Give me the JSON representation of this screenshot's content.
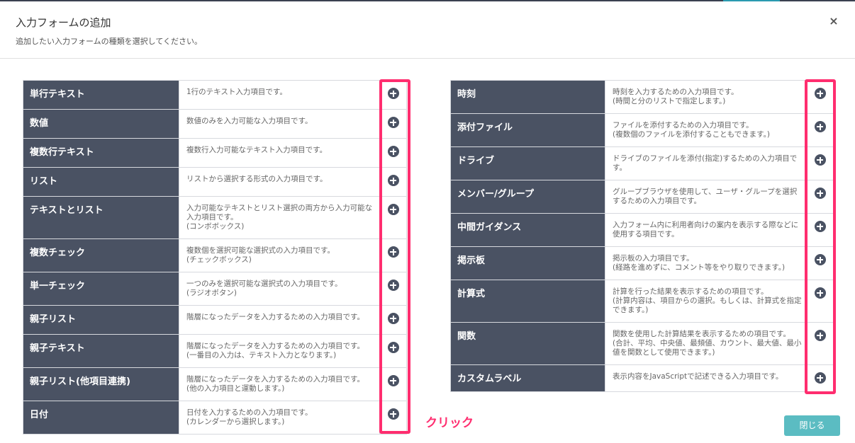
{
  "modal": {
    "title": "入力フォームの追加",
    "subtitle": "追加したい入力フォームの種類を選択してください。",
    "close_icon": "×",
    "close_button": "閉じる"
  },
  "annotation": {
    "click_label": "クリック"
  },
  "colors": {
    "row_header": "#4a5263",
    "highlight": "#ff2d6f",
    "close_button": "#5bbcc2"
  },
  "left_items": [
    {
      "name": "単行テキスト",
      "desc": [
        "1行のテキスト入力項目です。"
      ]
    },
    {
      "name": "数値",
      "desc": [
        "数値のみを入力可能な入力項目です。"
      ]
    },
    {
      "name": "複数行テキスト",
      "desc": [
        "複数行入力可能なテキスト入力項目です。"
      ]
    },
    {
      "name": "リスト",
      "desc": [
        "リストから選択する形式の入力項目です。"
      ]
    },
    {
      "name": "テキストとリスト",
      "desc": [
        "入力可能なテキストとリスト選択の両方から入力可能な",
        "入力項目です。",
        "(コンボボックス)"
      ]
    },
    {
      "name": "複数チェック",
      "desc": [
        "複数個を選択可能な選択式の入力項目です。",
        "(チェックボックス)"
      ]
    },
    {
      "name": "単一チェック",
      "desc": [
        "一つのみを選択可能な選択式の入力項目です。",
        "(ラジオボタン)"
      ]
    },
    {
      "name": "親子リスト",
      "desc": [
        "階層になったデータを入力するための入力項目です。"
      ]
    },
    {
      "name": "親子テキスト",
      "desc": [
        "階層になったデータを入力するための入力項目です。",
        "(一番目の入力は、テキスト入力となります。)"
      ]
    },
    {
      "name": "親子リスト(他項目連携)",
      "desc": [
        "階層になったデータを入力するための入力項目です。",
        "(他の入力項目と運動します。)"
      ]
    },
    {
      "name": "日付",
      "desc": [
        "日付を入力するための入力項目です。",
        "(カレンダーから選択します。)"
      ]
    }
  ],
  "right_items": [
    {
      "name": "時刻",
      "desc": [
        "時刻を入力するための入力項目です。",
        "(時間と分のリストで指定します。)"
      ]
    },
    {
      "name": "添付ファイル",
      "desc": [
        "ファイルを添付するための入力項目です。",
        "(複数個のファイルを添付することもできます。)"
      ]
    },
    {
      "name": "ドライブ",
      "desc": [
        "ドライブのファイルを添付(指定)するための入力項目で",
        "す。"
      ]
    },
    {
      "name": "メンバー/グループ",
      "desc": [
        "グループブラウザを使用して、ユーザ・グループを選択",
        "するための入力項目です。"
      ]
    },
    {
      "name": "中間ガイダンス",
      "desc": [
        "入力フォーム内に利用者向けの案内を表示する際などに",
        "使用する項目です。"
      ]
    },
    {
      "name": "掲示板",
      "desc": [
        "掲示板の入力項目です。",
        "(経路を進めずに、コメント等をやり取りできます。)"
      ]
    },
    {
      "name": "計算式",
      "desc": [
        "計算を行った結果を表示するための項目です。",
        "(計算内容は、項目からの選択。もしくは、計算式を指定",
        "できます。)"
      ]
    },
    {
      "name": "関数",
      "desc": [
        "関数を使用した計算結果を表示するための項目です。",
        "(合計、平均、中央値、最頻値、カウント、最大値、最小",
        "値を関数として使用できます。)"
      ]
    },
    {
      "name": "カスタムラベル",
      "desc": [
        "表示内容をJavaScriptで記述できる入力項目です。"
      ]
    }
  ]
}
